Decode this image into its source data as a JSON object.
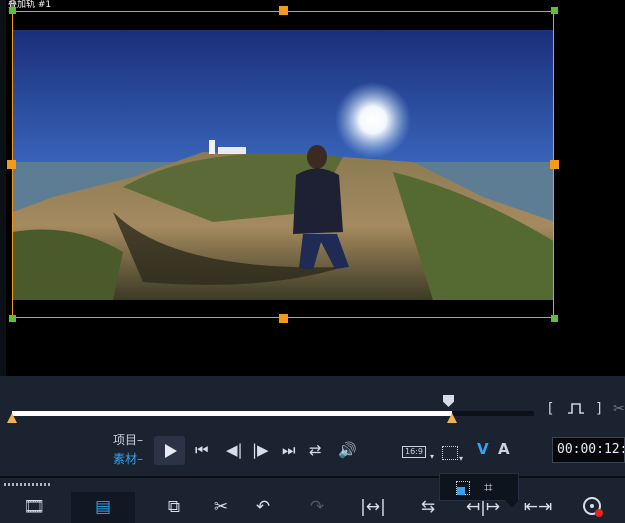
{
  "overlay": {
    "track_label": "叠加轨 #1"
  },
  "colors": {
    "accent": "#f39a1c",
    "active_blue": "#33a3f2",
    "corner_green": "#5ac234"
  },
  "scrubber": {
    "progress": 0.843
  },
  "mode": {
    "project_label": "项目",
    "clip_label": "素材"
  },
  "playback": {
    "play_icon": "play-icon",
    "to_start_icon": "skip-start-icon",
    "prev_frame_icon": "step-back-icon",
    "next_frame_icon": "step-forward-icon",
    "to_end_icon": "skip-end-icon",
    "repeat_icon": "repeat-icon",
    "volume_icon": "volume-icon"
  },
  "view": {
    "aspect_ratio": "16:9",
    "video_toggle": "V",
    "audio_toggle": "A"
  },
  "timecode": "00:00:12:"
}
